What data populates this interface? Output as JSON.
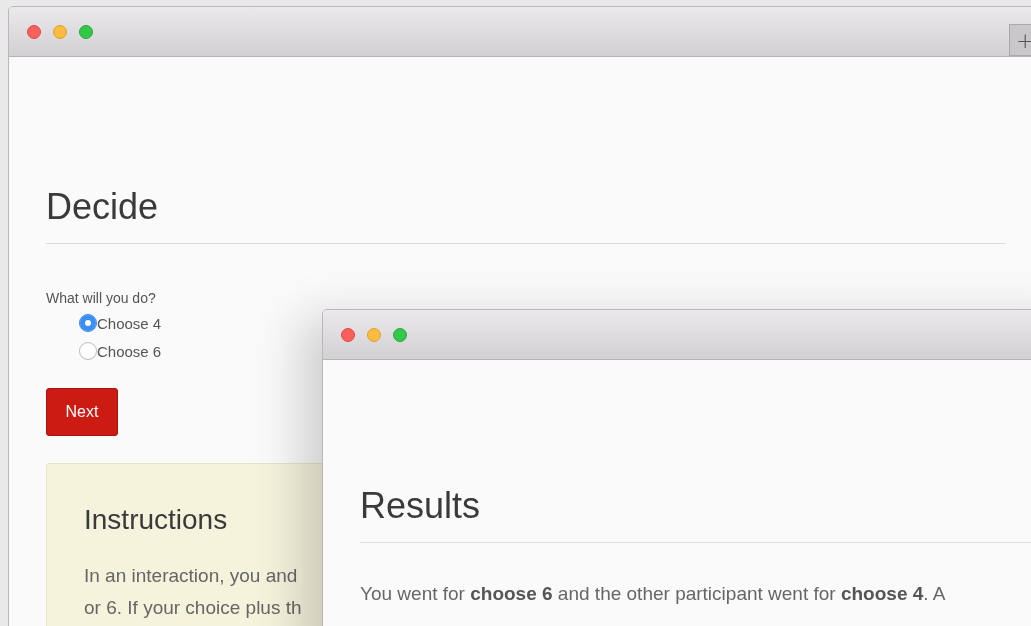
{
  "back_window": {
    "tab_button": "+",
    "heading": "Decide",
    "question": "What will you do?",
    "options": [
      {
        "label": "Choose 4",
        "selected": true
      },
      {
        "label": "Choose 6",
        "selected": false
      }
    ],
    "button": "Next",
    "instructions": {
      "title": "Instructions",
      "lines": [
        "In an interaction, you and",
        "or 6. If your choice plus th"
      ]
    }
  },
  "front_window": {
    "heading": "Results",
    "text": "You went for **choose 6** and the other participant went for **choose 4**. A"
  }
}
